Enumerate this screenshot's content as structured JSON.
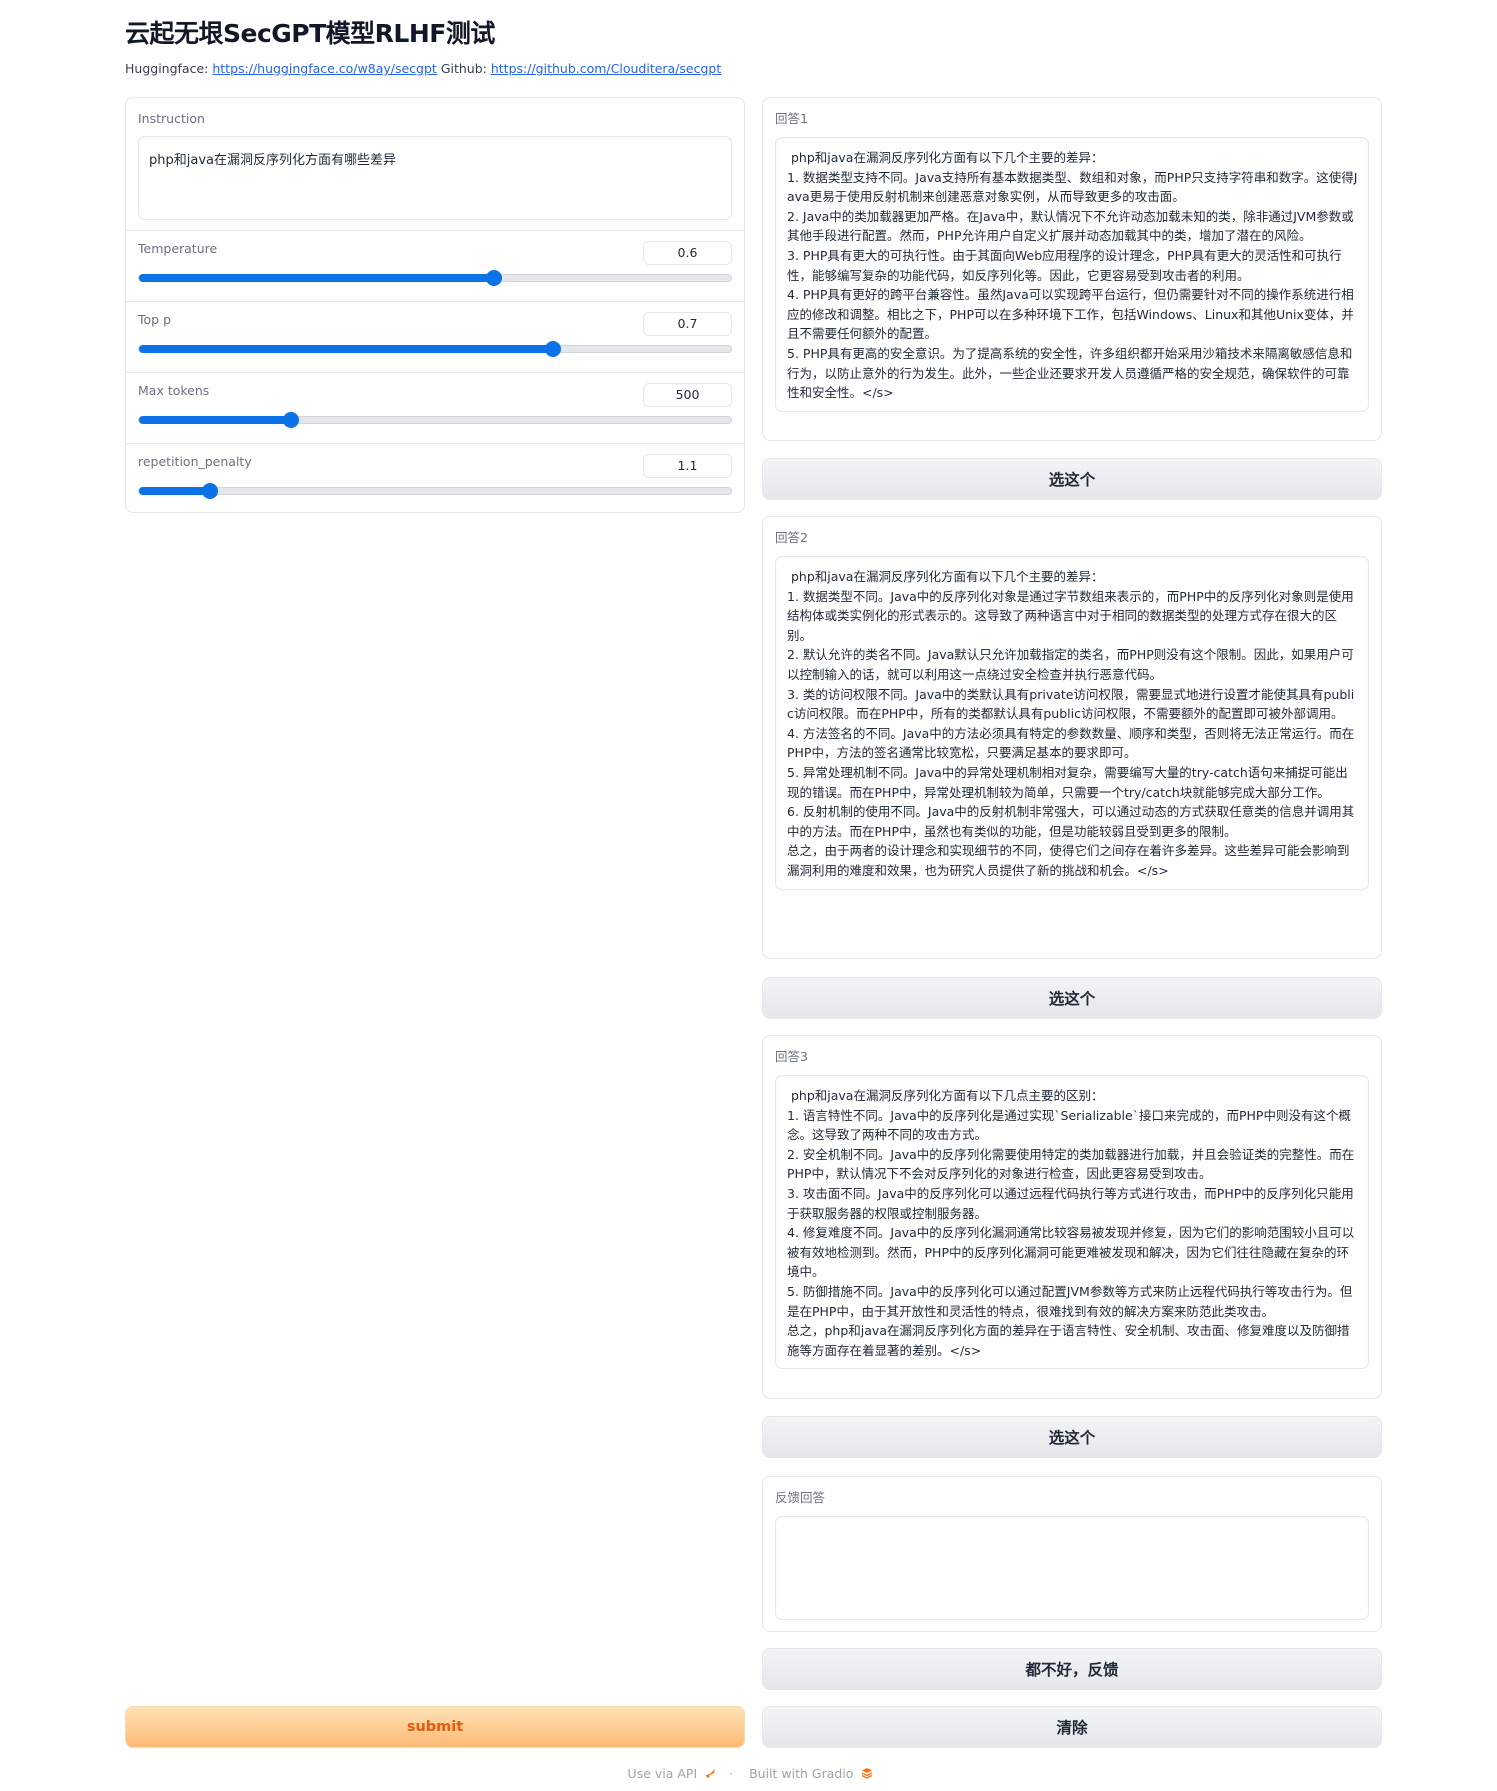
{
  "header": {
    "title": "云起无垠SecGPT模型RLHF测试",
    "hf_label": "Huggingface:",
    "hf_link": "https://huggingface.co/w8ay/secgpt",
    "gh_label": "Github:",
    "gh_link": "https://github.com/Clouditera/secgpt"
  },
  "form": {
    "instruction_label": "Instruction",
    "instruction_value": "php和java在漏洞反序列化方面有哪些差异",
    "sliders": [
      {
        "label": "Temperature",
        "value": "0.6",
        "fraction": 0.6
      },
      {
        "label": "Top p",
        "value": "0.7",
        "fraction": 0.7
      },
      {
        "label": "Max tokens",
        "value": "500",
        "fraction": 0.257
      },
      {
        "label": "repetition_penalty",
        "value": "1.1",
        "fraction": 0.12
      }
    ],
    "submit_label": "submit"
  },
  "answers": [
    {
      "label": "回答1",
      "text": " php和java在漏洞反序列化方面有以下几个主要的差异：\n1. 数据类型支持不同。Java支持所有基本数据类型、数组和对象，而PHP只支持字符串和数字。这使得Java更易于使用反射机制来创建恶意对象实例，从而导致更多的攻击面。\n2. Java中的类加载器更加严格。在Java中，默认情况下不允许动态加载未知的类，除非通过JVM参数或其他手段进行配置。然而，PHP允许用户自定义扩展并动态加载其中的类，增加了潜在的风险。\n3. PHP具有更大的可执行性。由于其面向Web应用程序的设计理念，PHP具有更大的灵活性和可执行性，能够编写复杂的功能代码，如反序列化等。因此，它更容易受到攻击者的利用。\n4. PHP具有更好的跨平台兼容性。虽然Java可以实现跨平台运行，但仍需要针对不同的操作系统进行相应的修改和调整。相比之下，PHP可以在多种环境下工作，包括Windows、Linux和其他Unix变体，并且不需要任何额外的配置。\n5. PHP具有更高的安全意识。为了提高系统的安全性，许多组织都开始采用沙箱技术来隔离敏感信息和行为，以防止意外的行为发生。此外，一些企业还要求开发人员遵循严格的安全规范，确保软件的可靠性和安全性。</s>",
      "button": "选这个"
    },
    {
      "label": "回答2",
      "text": " php和java在漏洞反序列化方面有以下几个主要的差异：\n1. 数据类型不同。Java中的反序列化对象是通过字节数组来表示的，而PHP中的反序列化对象则是使用结构体或类实例化的形式表示的。这导致了两种语言中对于相同的数据类型的处理方式存在很大的区别。\n2. 默认允许的类名不同。Java默认只允许加载指定的类名，而PHP则没有这个限制。因此，如果用户可以控制输入的话，就可以利用这一点绕过安全检查并执行恶意代码。\n3. 类的访问权限不同。Java中的类默认具有private访问权限，需要显式地进行设置才能使其具有public访问权限。而在PHP中，所有的类都默认具有public访问权限，不需要额外的配置即可被外部调用。\n4. 方法签名的不同。Java中的方法必须具有特定的参数数量、顺序和类型，否则将无法正常运行。而在PHP中，方法的签名通常比较宽松，只要满足基本的要求即可。\n5. 异常处理机制不同。Java中的异常处理机制相对复杂，需要编写大量的try-catch语句来捕捉可能出现的错误。而在PHP中，异常处理机制较为简单，只需要一个try/catch块就能够完成大部分工作。\n6. 反射机制的使用不同。Java中的反射机制非常强大，可以通过动态的方式获取任意类的信息并调用其中的方法。而在PHP中，虽然也有类似的功能，但是功能较弱且受到更多的限制。\n总之，由于两者的设计理念和实现细节的不同，使得它们之间存在着许多差异。这些差异可能会影响到漏洞利用的难度和效果，也为研究人员提供了新的挑战和机会。</s>",
      "button": "选这个"
    },
    {
      "label": "回答3",
      "text": " php和java在漏洞反序列化方面有以下几点主要的区别：\n1. 语言特性不同。Java中的反序列化是通过实现`Serializable`接口来完成的，而PHP中则没有这个概念。这导致了两种不同的攻击方式。\n2. 安全机制不同。Java中的反序列化需要使用特定的类加载器进行加载，并且会验证类的完整性。而在PHP中，默认情况下不会对反序列化的对象进行检查，因此更容易受到攻击。\n3. 攻击面不同。Java中的反序列化可以通过远程代码执行等方式进行攻击，而PHP中的反序列化只能用于获取服务器的权限或控制服务器。\n4. 修复难度不同。Java中的反序列化漏洞通常比较容易被发现并修复，因为它们的影响范围较小且可以被有效地检测到。然而，PHP中的反序列化漏洞可能更难被发现和解决，因为它们往往隐藏在复杂的环境中。\n5. 防御措施不同。Java中的反序列化可以通过配置JVM参数等方式来防止远程代码执行等攻击行为。但是在PHP中，由于其开放性和灵活性的特点，很难找到有效的解决方案来防范此类攻击。\n总之，php和java在漏洞反序列化方面的差异在于语言特性、安全机制、攻击面、修复难度以及防御措施等方面存在着显著的差别。</s>",
      "button": "选这个"
    }
  ],
  "feedback": {
    "label": "反馈回答",
    "value": "",
    "button": "都不好，反馈"
  },
  "clear_label": "清除",
  "footer": {
    "api": "Use via API",
    "sep": "·",
    "built": "Built with Gradio"
  },
  "colors": {
    "accent": "#0b72e7",
    "submit_bg": "#fdba74",
    "submit_text": "#ea580c",
    "link": "#2563eb"
  }
}
